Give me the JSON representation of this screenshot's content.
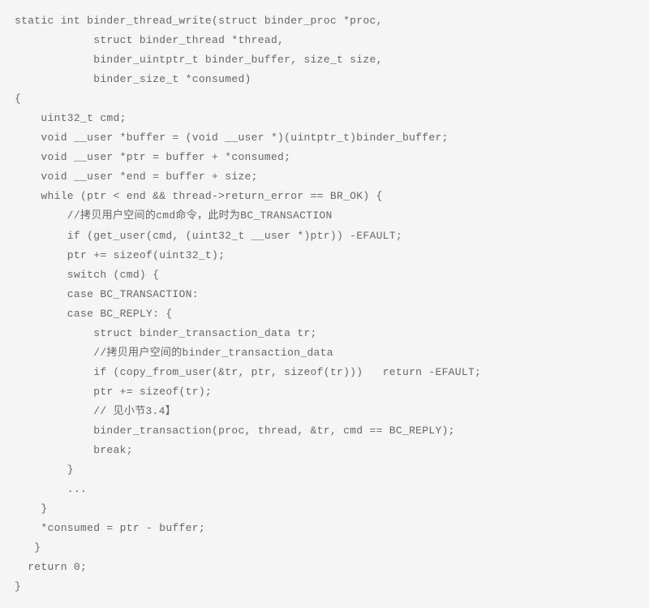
{
  "code": {
    "lines": [
      "static int binder_thread_write(struct binder_proc *proc,",
      "            struct binder_thread *thread,",
      "            binder_uintptr_t binder_buffer, size_t size,",
      "            binder_size_t *consumed)",
      "{",
      "    uint32_t cmd;",
      "    void __user *buffer = (void __user *)(uintptr_t)binder_buffer;",
      "    void __user *ptr = buffer + *consumed;",
      "    void __user *end = buffer + size;",
      "    while (ptr < end && thread->return_error == BR_OK) {",
      "        //拷贝用户空间的cmd命令，此时为BC_TRANSACTION",
      "        if (get_user(cmd, (uint32_t __user *)ptr)) -EFAULT;",
      "        ptr += sizeof(uint32_t);",
      "        switch (cmd) {",
      "        case BC_TRANSACTION:",
      "        case BC_REPLY: {",
      "            struct binder_transaction_data tr;",
      "            //拷贝用户空间的binder_transaction_data",
      "            if (copy_from_user(&tr, ptr, sizeof(tr)))   return -EFAULT;",
      "            ptr += sizeof(tr);",
      "            // 见小节3.4】",
      "            binder_transaction(proc, thread, &tr, cmd == BC_REPLY);",
      "            break;",
      "        }",
      "        ...",
      "    }",
      "    *consumed = ptr - buffer;",
      "   }",
      "  return 0;",
      "}"
    ]
  }
}
